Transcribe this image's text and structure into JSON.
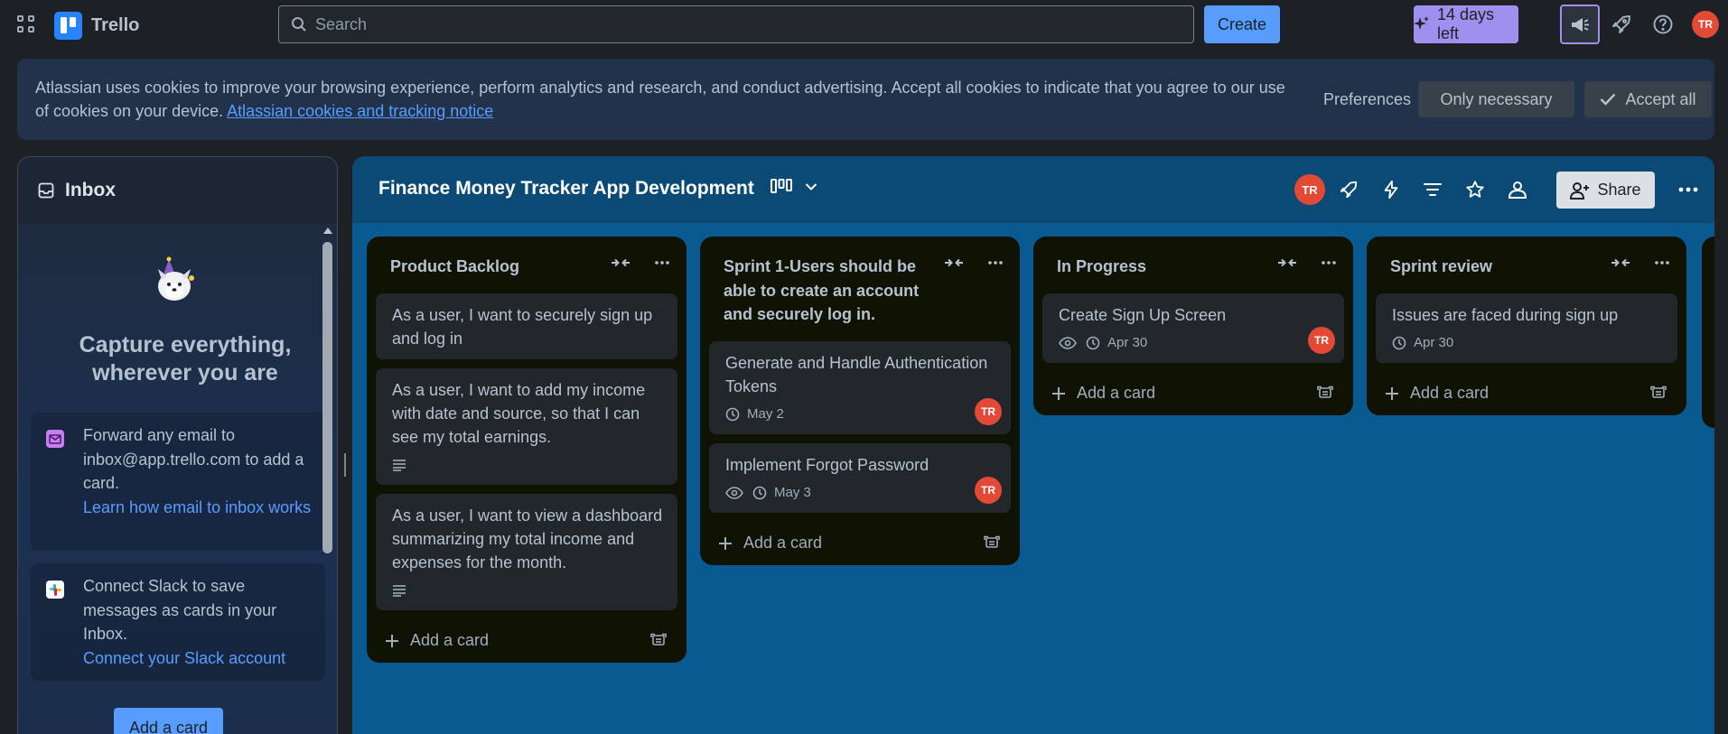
{
  "topbar": {
    "app_name": "Trello",
    "search_placeholder": "Search",
    "create_label": "Create",
    "trial_label": "14 days left",
    "user_initials": "TR"
  },
  "cookie_banner": {
    "text": "Atlassian uses cookies to improve your browsing experience, perform analytics and research, and conduct advertising. Accept all cookies to indicate that you agree to our use of cookies on your device.",
    "link": "Atlassian cookies and tracking notice",
    "preferences_label": "Preferences",
    "only_necessary_label": "Only necessary",
    "accept_all_label": "Accept all"
  },
  "inbox": {
    "title": "Inbox",
    "headline": "Capture everything, wherever you are",
    "email_card": {
      "text": "Forward any email to inbox@app.trello.com to add a card.",
      "link": "Learn how email to inbox works"
    },
    "slack_card": {
      "text": "Connect Slack to save messages as cards in your Inbox.",
      "link": "Connect your Slack account"
    },
    "add_card_label": "Add a card"
  },
  "board": {
    "title": "Finance Money Tracker App Development",
    "member_initials": "TR",
    "share_label": "Share",
    "add_card_label": "Add a card",
    "lists": [
      {
        "title": "Product Backlog",
        "cards": [
          {
            "title": "As a user, I want to securely sign up and log in"
          },
          {
            "title": "As a user, I want to add my income with date and source, so that I can see my total earnings."
          },
          {
            "title": "As a user, I want to view a dashboard summarizing my total income and expenses for the month."
          }
        ]
      },
      {
        "title": "Sprint 1-Users should be able to create an account and securely log in.",
        "cards": [
          {
            "title": "Generate and Handle Authentication Tokens",
            "date": "May 2",
            "member": "TR"
          },
          {
            "title": "Implement Forgot Password",
            "date": "May 3",
            "member": "TR"
          }
        ]
      },
      {
        "title": "In Progress",
        "cards": [
          {
            "title": "Create Sign Up Screen",
            "date": "Apr 30",
            "member": "TR"
          }
        ]
      },
      {
        "title": "Sprint review",
        "cards": [
          {
            "title": "Issues are faced during sign up",
            "date": "Apr 30"
          }
        ]
      }
    ]
  }
}
